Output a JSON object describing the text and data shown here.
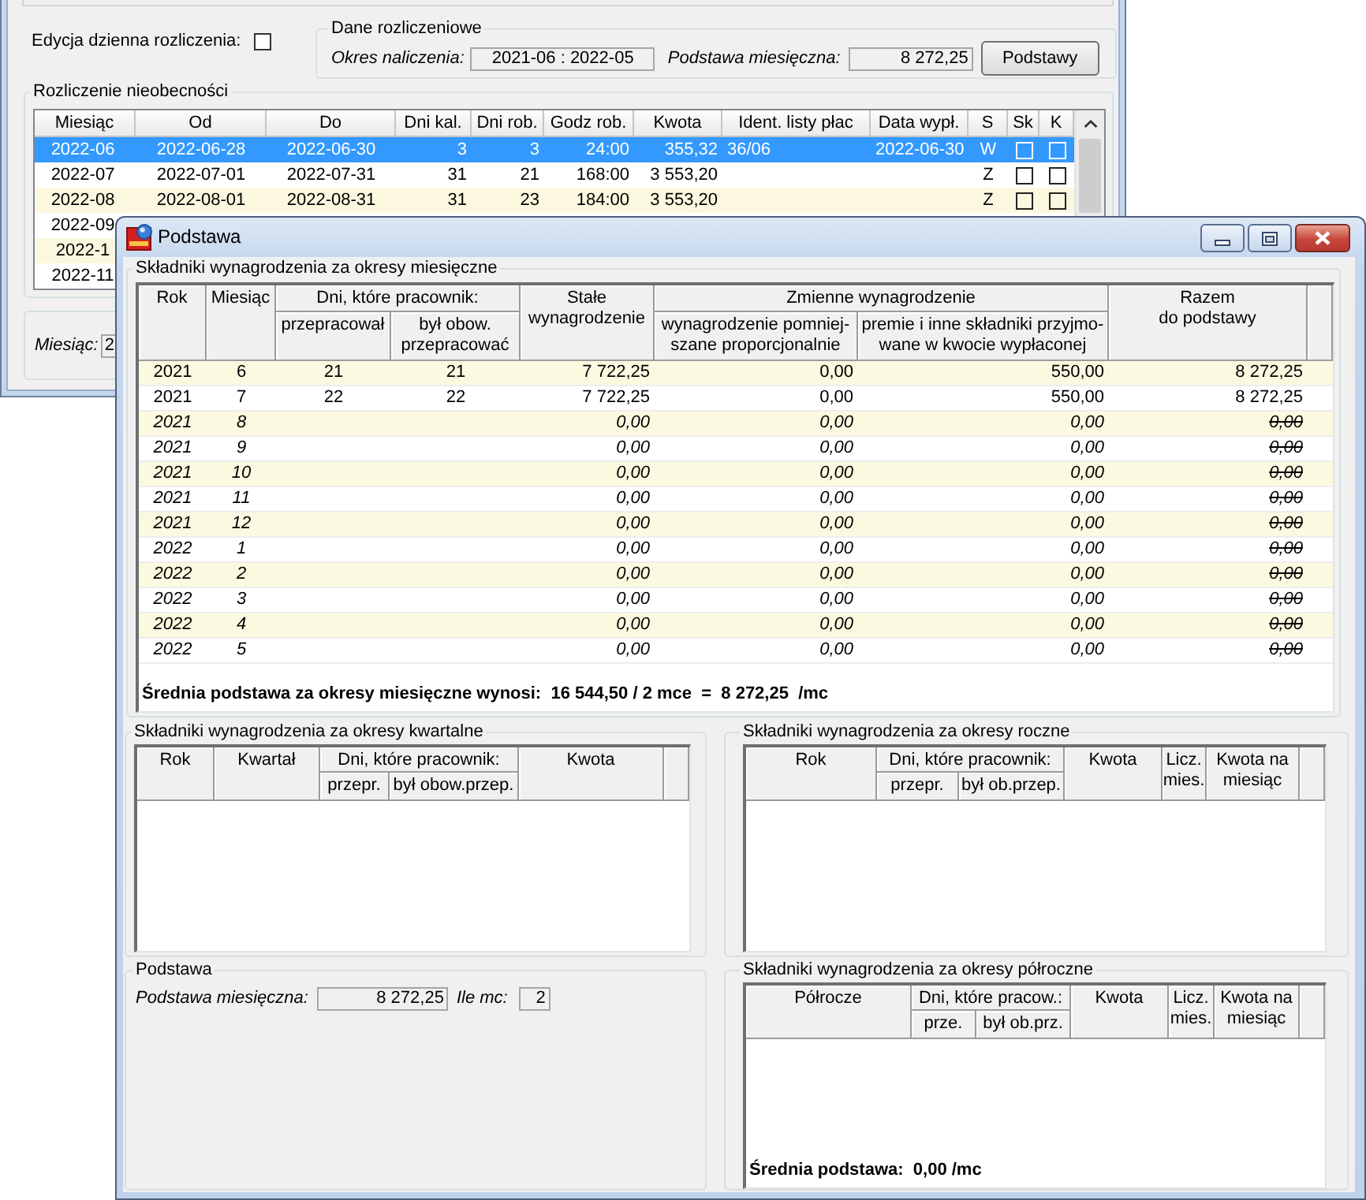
{
  "background_window": {
    "daily_edit": {
      "label": "Edycja dzienna rozliczenia:",
      "checked": false
    },
    "settlement": {
      "title": "Dane rozliczeniowe",
      "period_label": "Okres naliczenia:",
      "period_value": "2021-06 : 2022-05",
      "base_label": "Podstawa miesięczna:",
      "base_value": "8 272,25",
      "button": "Podstawy"
    },
    "absences": {
      "title": "Rozliczenie nieobecności",
      "columns": [
        "Miesiąc",
        "Od",
        "Do",
        "Dni kal.",
        "Dni rob.",
        "Godz rob.",
        "Kwota",
        "Ident. listy płac",
        "Data wypł.",
        "S",
        "Sk",
        "K"
      ],
      "rows": [
        {
          "month": "2022-06",
          "from": "2022-06-28",
          "to": "2022-06-30",
          "cal_days": "3",
          "work_days": "3",
          "work_hours": "24:00",
          "amount": "355,32",
          "payroll_id": "36/06",
          "pay_date": "2022-06-30",
          "status": "W",
          "sk": false,
          "k": false,
          "selected": true
        },
        {
          "month": "2022-07",
          "from": "2022-07-01",
          "to": "2022-07-31",
          "cal_days": "31",
          "work_days": "21",
          "work_hours": "168:00",
          "amount": "3 553,20",
          "status": "Z",
          "sk": false,
          "k": false,
          "selected": false
        },
        {
          "month": "2022-08",
          "from": "2022-08-01",
          "to": "2022-08-31",
          "cal_days": "31",
          "work_days": "23",
          "work_hours": "184:00",
          "amount": "3 553,20",
          "status": "Z",
          "sk": false,
          "k": false,
          "selected": false
        },
        {
          "month": "2022-09",
          "selected": false
        },
        {
          "month": "2022-1",
          "selected": false
        },
        {
          "month": "2022-11",
          "selected": false
        }
      ]
    },
    "month_field": {
      "label": "Miesiąc:",
      "value": "2"
    }
  },
  "dialog": {
    "title": "Podstawa",
    "monthly": {
      "title": "Składniki wynagrodzenia za okresy miesięczne",
      "columns": [
        {
          "label": "Rok"
        },
        {
          "label": "Miesiąc"
        },
        {
          "label": "Dni, które pracownik:",
          "children": [
            {
              "label": "przepracował"
            },
            {
              "label": "był obow.\nprzepracować"
            }
          ]
        },
        {
          "label": "Stałe\nwynagrodzenie"
        },
        {
          "label": "Zmienne wynagrodzenie",
          "children": [
            {
              "label": "wynagrodzenie pomniej-\nszane proporcjonalnie"
            },
            {
              "label": "premie i inne składniki przyjmo-\nwane w kwocie wypłaconej"
            }
          ]
        },
        {
          "label": "Razem\ndo podstawy"
        }
      ],
      "rows": [
        {
          "year": "2021",
          "month": "6",
          "days_worked": "21",
          "days_required": "21",
          "fixed_pay": "7 722,25",
          "reduced_pay": "0,00",
          "bonus_pay": "550,00",
          "total": "8 272,25",
          "excluded": false
        },
        {
          "year": "2021",
          "month": "7",
          "days_worked": "22",
          "days_required": "22",
          "fixed_pay": "7 722,25",
          "reduced_pay": "0,00",
          "bonus_pay": "550,00",
          "total": "8 272,25",
          "excluded": false
        },
        {
          "year": "2021",
          "month": "8",
          "fixed_pay": "0,00",
          "reduced_pay": "0,00",
          "bonus_pay": "0,00",
          "total": "0,00",
          "excluded": true
        },
        {
          "year": "2021",
          "month": "9",
          "fixed_pay": "0,00",
          "reduced_pay": "0,00",
          "bonus_pay": "0,00",
          "total": "0,00",
          "excluded": true
        },
        {
          "year": "2021",
          "month": "10",
          "fixed_pay": "0,00",
          "reduced_pay": "0,00",
          "bonus_pay": "0,00",
          "total": "0,00",
          "excluded": true
        },
        {
          "year": "2021",
          "month": "11",
          "fixed_pay": "0,00",
          "reduced_pay": "0,00",
          "bonus_pay": "0,00",
          "total": "0,00",
          "excluded": true
        },
        {
          "year": "2021",
          "month": "12",
          "fixed_pay": "0,00",
          "reduced_pay": "0,00",
          "bonus_pay": "0,00",
          "total": "0,00",
          "excluded": true
        },
        {
          "year": "2022",
          "month": "1",
          "fixed_pay": "0,00",
          "reduced_pay": "0,00",
          "bonus_pay": "0,00",
          "total": "0,00",
          "excluded": true
        },
        {
          "year": "2022",
          "month": "2",
          "fixed_pay": "0,00",
          "reduced_pay": "0,00",
          "bonus_pay": "0,00",
          "total": "0,00",
          "excluded": true
        },
        {
          "year": "2022",
          "month": "3",
          "fixed_pay": "0,00",
          "reduced_pay": "0,00",
          "bonus_pay": "0,00",
          "total": "0,00",
          "excluded": true
        },
        {
          "year": "2022",
          "month": "4",
          "fixed_pay": "0,00",
          "reduced_pay": "0,00",
          "bonus_pay": "0,00",
          "total": "0,00",
          "excluded": true
        },
        {
          "year": "2022",
          "month": "5",
          "fixed_pay": "0,00",
          "reduced_pay": "0,00",
          "bonus_pay": "0,00",
          "total": "0,00",
          "excluded": true
        }
      ],
      "summary": "Średnia podstawa za okresy miesięczne wynosi:  16 544,50 / 2 mce  =  8 272,25  /mc"
    },
    "quarterly": {
      "title": "Składniki wynagrodzenia za okresy kwartalne",
      "columns": [
        {
          "label": "Rok"
        },
        {
          "label": "Kwartał"
        },
        {
          "label": "Dni, które pracownik:",
          "children": [
            {
              "label": "przepr."
            },
            {
              "label": "był obow.przep."
            }
          ]
        },
        {
          "label": "Kwota"
        }
      ]
    },
    "base": {
      "title": "Podstawa",
      "monthly_label": "Podstawa miesięczna:",
      "monthly_value": "8 272,25",
      "months_label": "Ile mc:",
      "months_value": "2"
    },
    "yearly": {
      "title": "Składniki wynagrodzenia za okresy roczne",
      "columns": [
        {
          "label": "Rok"
        },
        {
          "label": "Dni, które pracownik:",
          "children": [
            {
              "label": "przepr."
            },
            {
              "label": "był ob.przep."
            }
          ]
        },
        {
          "label": "Kwota"
        },
        {
          "label": "Licz.\nmies."
        },
        {
          "label": "Kwota na\nmiesiąc"
        }
      ]
    },
    "half_yearly": {
      "title": "Składniki wynagrodzenia za okresy półroczne",
      "columns": [
        {
          "label": "Półrocze"
        },
        {
          "label": "Dni, które pracow.:",
          "children": [
            {
              "label": "prze."
            },
            {
              "label": "był ob.prz."
            }
          ]
        },
        {
          "label": "Kwota"
        },
        {
          "label": "Licz.\nmies."
        },
        {
          "label": "Kwota na\nmiesiąc"
        }
      ],
      "summary": "Średnia podstawa:  0,00 /mc"
    }
  }
}
